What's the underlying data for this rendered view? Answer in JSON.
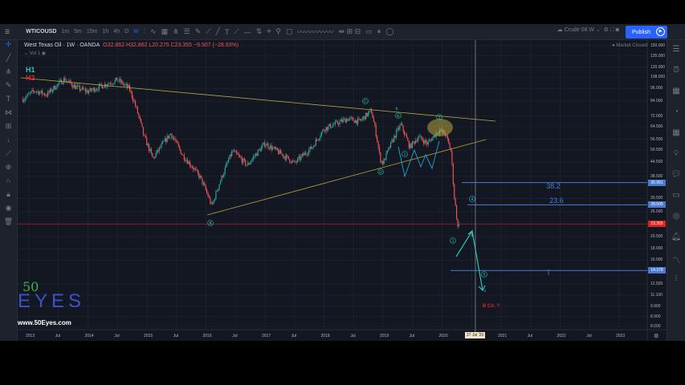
{
  "toolbar": {
    "symbol": "WTICOUSD",
    "intervals": [
      "1m",
      "5m",
      "15m",
      "1h",
      "4h",
      "D",
      "W"
    ],
    "active_interval": "W",
    "layout_name": "Crude 08.W",
    "publish_label": "Publish"
  },
  "legend": {
    "title": "West Texas Oil · 1W · OANDA",
    "ohlc": "O32.862 H32.862 L20.275 C23.355 −9.507 (−28.93%)",
    "volume": "Vol 1"
  },
  "market_status": "● Market Closed",
  "price_axis": [
    "150.000",
    "135.000",
    "120.000",
    "108.000",
    "96.000",
    "84.000",
    "72.000",
    "64.500",
    "56.500",
    "50.500",
    "44.500",
    "38.500",
    "30.500",
    "26.500",
    "20.500",
    "18.000",
    "16.000",
    "12.500",
    "11.100",
    "9.900",
    "8.900",
    "8.000"
  ],
  "price_tags": [
    {
      "label": "35.991",
      "price": 35.991,
      "color": "#4a7bd0"
    },
    {
      "label": "28.505",
      "price": 28.505,
      "color": "#4a7bd0"
    },
    {
      "label": "23.355",
      "price": 23.355,
      "color": "#e0221f"
    },
    {
      "label": "14.378",
      "price": 14.378,
      "color": "#4a7bd0"
    }
  ],
  "time_axis": [
    "2013",
    "Jul",
    "2014",
    "Jul",
    "2015",
    "Jul",
    "2016",
    "Jul",
    "2017",
    "Jul",
    "2018",
    "Jul",
    "2019",
    "Jul",
    "2020",
    "Jul",
    "2021",
    "Jul",
    "2022",
    "Jul",
    "2023"
  ],
  "crosshair_date": "27 Jul '20",
  "annotations": {
    "h1": "H1",
    "h2": "H2",
    "fib_382": "38.2",
    "fib_236": "23.6",
    "waves": [
      "C",
      "b",
      "E",
      "D",
      "1",
      "3",
      "B",
      "1",
      "4",
      "5",
      "c",
      "T"
    ],
    "note": "B Cir. ?"
  },
  "colors": {
    "up": "#26a69a",
    "down": "#ef5350",
    "trend": "#b5a642",
    "fib": "#4a7bd0",
    "wave": "#2ec4b6"
  },
  "price_path": [
    [
      2012.9,
      86
    ],
    [
      2013.1,
      94
    ],
    [
      2013.3,
      90
    ],
    [
      2013.6,
      106
    ],
    [
      2013.8,
      97
    ],
    [
      2014.0,
      93
    ],
    [
      2014.5,
      105
    ],
    [
      2014.7,
      96
    ],
    [
      2014.95,
      58
    ],
    [
      2015.1,
      46
    ],
    [
      2015.4,
      60
    ],
    [
      2015.6,
      48
    ],
    [
      2015.9,
      38
    ],
    [
      2016.1,
      28
    ],
    [
      2016.3,
      40
    ],
    [
      2016.45,
      50
    ],
    [
      2016.7,
      43
    ],
    [
      2017.0,
      54
    ],
    [
      2017.4,
      46
    ],
    [
      2017.5,
      44
    ],
    [
      2017.8,
      52
    ],
    [
      2018.0,
      63
    ],
    [
      2018.4,
      70
    ],
    [
      2018.6,
      68
    ],
    [
      2018.8,
      76
    ],
    [
      2018.95,
      46
    ],
    [
      2019.0,
      44
    ],
    [
      2019.3,
      66
    ],
    [
      2019.45,
      52
    ],
    [
      2019.6,
      58
    ],
    [
      2019.75,
      54
    ],
    [
      2019.95,
      62
    ],
    [
      2020.05,
      60
    ],
    [
      2020.15,
      50
    ],
    [
      2020.2,
      32
    ],
    [
      2020.28,
      20.3
    ],
    [
      2020.3,
      23.355
    ]
  ],
  "last_close": 23.355
}
